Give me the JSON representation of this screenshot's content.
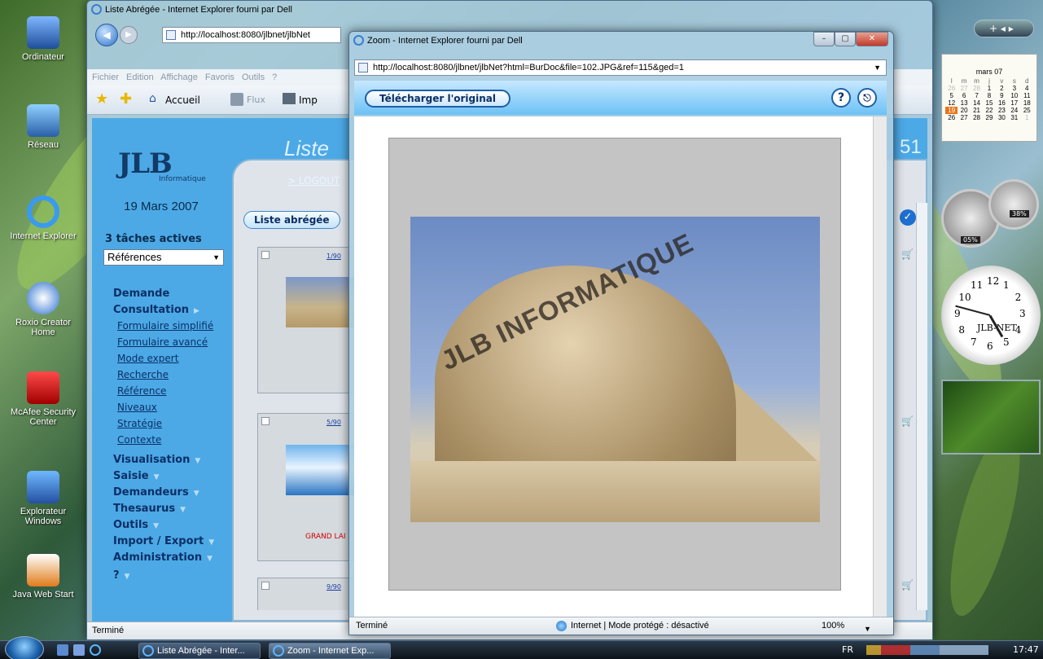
{
  "desktop": {
    "icons": [
      {
        "label": "Ordinateur"
      },
      {
        "label": "Réseau"
      },
      {
        "label": "Internet Explorer"
      },
      {
        "label": "Roxio Creator Home"
      },
      {
        "label": "McAfee Security Center"
      },
      {
        "label": "Explorateur Windows"
      },
      {
        "label": "Java Web Start"
      }
    ]
  },
  "sidebar_gadgets": {
    "calendar": {
      "month": "mars 07",
      "weekdays": [
        "l",
        "m",
        "m",
        "j",
        "v",
        "s",
        "d"
      ],
      "rows": [
        [
          "26",
          "27",
          "28",
          "1",
          "2",
          "3",
          "4"
        ],
        [
          "5",
          "6",
          "7",
          "8",
          "9",
          "10",
          "11"
        ],
        [
          "12",
          "13",
          "14",
          "15",
          "16",
          "17",
          "18"
        ],
        [
          "19",
          "20",
          "21",
          "22",
          "23",
          "24",
          "25"
        ],
        [
          "26",
          "27",
          "28",
          "29",
          "30",
          "31",
          "1"
        ]
      ],
      "today": "19"
    },
    "meter_cpu": "05%",
    "meter_mem": "38%",
    "clock_label": "JLB-NET",
    "clock_numbers": [
      "12",
      "1",
      "2",
      "3",
      "4",
      "5",
      "6",
      "7",
      "8",
      "9",
      "10",
      "11"
    ]
  },
  "main_window": {
    "title": "Liste Abrégée - Internet Explorer fourni par Dell",
    "address": "http://localhost:8080/jlbnet/jlbNet",
    "menu": "Fichier   Edition   Affichage   Favoris   Outils   ?",
    "toolbar": {
      "home": "Accueil",
      "feeds": "Flux",
      "print": "Imp"
    },
    "status": "Terminé",
    "page": {
      "logo": "JLB",
      "logo_sub": "Informatique",
      "date": "19 Mars 2007",
      "tasks": "3 tâches actives",
      "select_value": "Références",
      "heading": "Liste",
      "logout": "> LOGOUT",
      "tab": "Liste abrégée",
      "right_number": "51",
      "nav": [
        {
          "label": "Demande",
          "type": "bold"
        },
        {
          "label": "Consultation",
          "type": "bold",
          "arrow": "right"
        },
        {
          "label": "Formulaire simplifié",
          "type": "link"
        },
        {
          "label": "Formulaire avancé",
          "type": "link"
        },
        {
          "label": "Mode expert",
          "type": "link"
        },
        {
          "label": "Recherche",
          "type": "link"
        },
        {
          "label": "Référence",
          "type": "link"
        },
        {
          "label": "Niveaux",
          "type": "link"
        },
        {
          "label": "Stratégie",
          "type": "link"
        },
        {
          "label": "Contexte",
          "type": "link"
        },
        {
          "label": "Visualisation",
          "type": "bold",
          "arrow": "down"
        },
        {
          "label": "Saisie",
          "type": "bold",
          "arrow": "down"
        },
        {
          "label": "Demandeurs",
          "type": "bold",
          "arrow": "down"
        },
        {
          "label": "Thesaurus",
          "type": "bold",
          "arrow": "down"
        },
        {
          "label": "Outils",
          "type": "bold",
          "arrow": "down"
        },
        {
          "label": "Import / Export",
          "type": "bold",
          "arrow": "down"
        },
        {
          "label": "Administration",
          "type": "bold",
          "arrow": "down"
        },
        {
          "label": "?",
          "type": "bold",
          "arrow": "down"
        }
      ],
      "cards": [
        {
          "num": "1/90",
          "caption": ""
        },
        {
          "num": "5/90",
          "caption": "GRAND LAI"
        },
        {
          "num": "9/90",
          "caption": ""
        }
      ]
    }
  },
  "zoom_window": {
    "title": "Zoom - Internet Explorer fourni par Dell",
    "address": "http://localhost:8080/jlbnet/jlbNet?html=BurDoc&file=102.JPG&ref=115&ged=1",
    "download_label": "Télécharger l'original",
    "help_glyph": "?",
    "exit_glyph": "⎋",
    "watermark": "JLB INFORMATIQUE",
    "status_left": "Terminé",
    "status_zone": "Internet | Mode protégé : désactivé",
    "zoom_level": "100%"
  },
  "taskbar": {
    "items": [
      "Liste Abrégée - Inter...",
      "Zoom - Internet Exp..."
    ],
    "lang": "FR",
    "time": "17:47"
  },
  "colors": {
    "page_blue": "#4ca9e6",
    "nav_text": "#0b2f66",
    "accent_red": "#cc0000"
  }
}
